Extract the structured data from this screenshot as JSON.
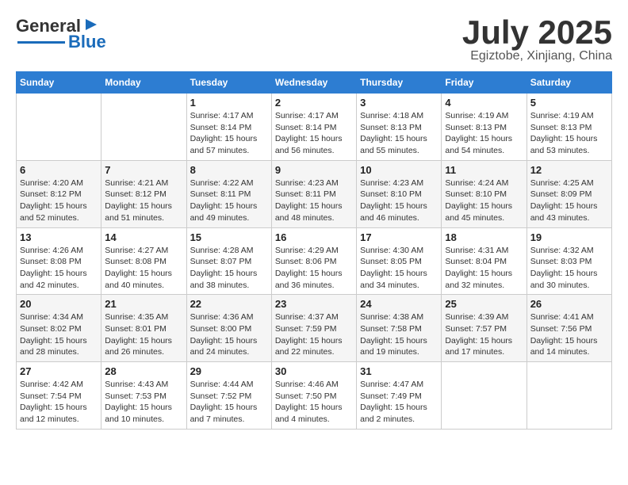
{
  "header": {
    "logo_line1": "General",
    "logo_line2": "Blue",
    "month": "July 2025",
    "location": "Egiztobe, Xinjiang, China"
  },
  "days_of_week": [
    "Sunday",
    "Monday",
    "Tuesday",
    "Wednesday",
    "Thursday",
    "Friday",
    "Saturday"
  ],
  "weeks": [
    [
      {
        "day": "",
        "info": ""
      },
      {
        "day": "",
        "info": ""
      },
      {
        "day": "1",
        "info": "Sunrise: 4:17 AM\nSunset: 8:14 PM\nDaylight: 15 hours and 57 minutes."
      },
      {
        "day": "2",
        "info": "Sunrise: 4:17 AM\nSunset: 8:14 PM\nDaylight: 15 hours and 56 minutes."
      },
      {
        "day": "3",
        "info": "Sunrise: 4:18 AM\nSunset: 8:13 PM\nDaylight: 15 hours and 55 minutes."
      },
      {
        "day": "4",
        "info": "Sunrise: 4:19 AM\nSunset: 8:13 PM\nDaylight: 15 hours and 54 minutes."
      },
      {
        "day": "5",
        "info": "Sunrise: 4:19 AM\nSunset: 8:13 PM\nDaylight: 15 hours and 53 minutes."
      }
    ],
    [
      {
        "day": "6",
        "info": "Sunrise: 4:20 AM\nSunset: 8:12 PM\nDaylight: 15 hours and 52 minutes."
      },
      {
        "day": "7",
        "info": "Sunrise: 4:21 AM\nSunset: 8:12 PM\nDaylight: 15 hours and 51 minutes."
      },
      {
        "day": "8",
        "info": "Sunrise: 4:22 AM\nSunset: 8:11 PM\nDaylight: 15 hours and 49 minutes."
      },
      {
        "day": "9",
        "info": "Sunrise: 4:23 AM\nSunset: 8:11 PM\nDaylight: 15 hours and 48 minutes."
      },
      {
        "day": "10",
        "info": "Sunrise: 4:23 AM\nSunset: 8:10 PM\nDaylight: 15 hours and 46 minutes."
      },
      {
        "day": "11",
        "info": "Sunrise: 4:24 AM\nSunset: 8:10 PM\nDaylight: 15 hours and 45 minutes."
      },
      {
        "day": "12",
        "info": "Sunrise: 4:25 AM\nSunset: 8:09 PM\nDaylight: 15 hours and 43 minutes."
      }
    ],
    [
      {
        "day": "13",
        "info": "Sunrise: 4:26 AM\nSunset: 8:08 PM\nDaylight: 15 hours and 42 minutes."
      },
      {
        "day": "14",
        "info": "Sunrise: 4:27 AM\nSunset: 8:08 PM\nDaylight: 15 hours and 40 minutes."
      },
      {
        "day": "15",
        "info": "Sunrise: 4:28 AM\nSunset: 8:07 PM\nDaylight: 15 hours and 38 minutes."
      },
      {
        "day": "16",
        "info": "Sunrise: 4:29 AM\nSunset: 8:06 PM\nDaylight: 15 hours and 36 minutes."
      },
      {
        "day": "17",
        "info": "Sunrise: 4:30 AM\nSunset: 8:05 PM\nDaylight: 15 hours and 34 minutes."
      },
      {
        "day": "18",
        "info": "Sunrise: 4:31 AM\nSunset: 8:04 PM\nDaylight: 15 hours and 32 minutes."
      },
      {
        "day": "19",
        "info": "Sunrise: 4:32 AM\nSunset: 8:03 PM\nDaylight: 15 hours and 30 minutes."
      }
    ],
    [
      {
        "day": "20",
        "info": "Sunrise: 4:34 AM\nSunset: 8:02 PM\nDaylight: 15 hours and 28 minutes."
      },
      {
        "day": "21",
        "info": "Sunrise: 4:35 AM\nSunset: 8:01 PM\nDaylight: 15 hours and 26 minutes."
      },
      {
        "day": "22",
        "info": "Sunrise: 4:36 AM\nSunset: 8:00 PM\nDaylight: 15 hours and 24 minutes."
      },
      {
        "day": "23",
        "info": "Sunrise: 4:37 AM\nSunset: 7:59 PM\nDaylight: 15 hours and 22 minutes."
      },
      {
        "day": "24",
        "info": "Sunrise: 4:38 AM\nSunset: 7:58 PM\nDaylight: 15 hours and 19 minutes."
      },
      {
        "day": "25",
        "info": "Sunrise: 4:39 AM\nSunset: 7:57 PM\nDaylight: 15 hours and 17 minutes."
      },
      {
        "day": "26",
        "info": "Sunrise: 4:41 AM\nSunset: 7:56 PM\nDaylight: 15 hours and 14 minutes."
      }
    ],
    [
      {
        "day": "27",
        "info": "Sunrise: 4:42 AM\nSunset: 7:54 PM\nDaylight: 15 hours and 12 minutes."
      },
      {
        "day": "28",
        "info": "Sunrise: 4:43 AM\nSunset: 7:53 PM\nDaylight: 15 hours and 10 minutes."
      },
      {
        "day": "29",
        "info": "Sunrise: 4:44 AM\nSunset: 7:52 PM\nDaylight: 15 hours and 7 minutes."
      },
      {
        "day": "30",
        "info": "Sunrise: 4:46 AM\nSunset: 7:50 PM\nDaylight: 15 hours and 4 minutes."
      },
      {
        "day": "31",
        "info": "Sunrise: 4:47 AM\nSunset: 7:49 PM\nDaylight: 15 hours and 2 minutes."
      },
      {
        "day": "",
        "info": ""
      },
      {
        "day": "",
        "info": ""
      }
    ]
  ]
}
